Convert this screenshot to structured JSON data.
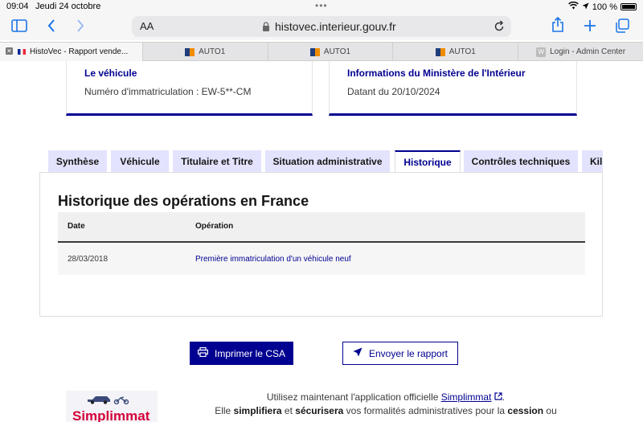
{
  "status": {
    "time": "09:04",
    "date": "Jeudi 24 octobre",
    "battery": "100 %"
  },
  "browser": {
    "aa_label": "AA",
    "url": "histovec.interieur.gouv.fr",
    "tabs": [
      {
        "label": "HistoVec - Rapport vende...",
        "icon": "fr-flag-icon"
      },
      {
        "label": "AUTO1",
        "icon": "auto1-icon"
      },
      {
        "label": "AUTO1",
        "icon": "auto1-icon"
      },
      {
        "label": "AUTO1",
        "icon": "auto1-icon"
      },
      {
        "label": "Login - Admin Center",
        "icon": "w-icon",
        "badge": "W"
      }
    ]
  },
  "cards": {
    "vehicle": {
      "title": "Le véhicule",
      "text": "Numéro d'immatriculation : EW-5**-CM"
    },
    "ministry": {
      "title": "Informations du Ministère de l'Intérieur",
      "text": "Datant du 20/10/2024"
    }
  },
  "nav_tabs": [
    {
      "label": "Synthèse"
    },
    {
      "label": "Véhicule"
    },
    {
      "label": "Titulaire et Titre"
    },
    {
      "label": "Situation administrative"
    },
    {
      "label": "Historique"
    },
    {
      "label": "Contrôles techniques"
    },
    {
      "label": "Kilométrage"
    }
  ],
  "active_tab": "Historique",
  "history": {
    "title": "Historique des opérations en France",
    "columns": [
      "Date",
      "Opération"
    ],
    "rows": [
      {
        "date": "28/03/2018",
        "operation": "Première immatriculation d'un véhicule neuf"
      }
    ]
  },
  "actions": {
    "print_label": "Imprimer le CSA",
    "send_label": "Envoyer le rapport"
  },
  "promo": {
    "logo_text": "Simplimmat",
    "line1_pre": "Utilisez maintenant l'application officielle ",
    "line1_link": "Simplimmat",
    "line1_post": ".",
    "line2_a": "Elle ",
    "line2_b": "simplifiera",
    "line2_c": " et ",
    "line2_d": "sécurisera",
    "line2_e": " vos formalités administratives pour la ",
    "line2_f": "cession",
    "line2_g": " ou"
  },
  "colors": {
    "primary": "#000091",
    "tab_bg": "#e3e3fd",
    "brand_red": "#d4003a"
  }
}
